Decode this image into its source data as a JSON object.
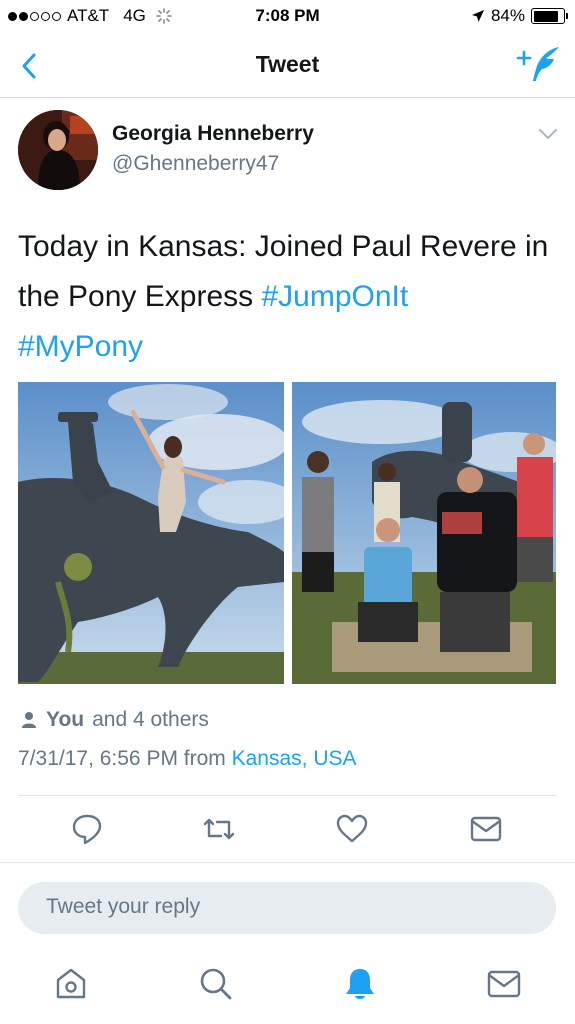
{
  "status_bar": {
    "carrier": "AT&T",
    "network": "4G",
    "time": "7:08 PM",
    "battery": "84%",
    "battery_level": 0.84
  },
  "nav": {
    "title": "Tweet",
    "back_icon": "chevron-left-icon",
    "compose_icon": "compose-tweet-icon"
  },
  "tweet": {
    "author_name": "Georgia Henneberry",
    "author_handle": "@Ghenneberry47",
    "text_plain": "Today in Kansas: Joined Paul Revere in the Pony Express ",
    "hashtag_1": "#JumpOnIt",
    "hashtag_2": "#MyPony",
    "likes_you": "You",
    "likes_rest": "and 4 others",
    "timestamp": "7/31/17, 6:56 PM from ",
    "location": "Kansas, USA"
  },
  "actions": [
    "reply-icon",
    "retweet-icon",
    "like-icon",
    "direct-message-icon"
  ],
  "reply": {
    "placeholder": "Tweet your reply"
  },
  "tab_bar": [
    "home-icon",
    "search-icon",
    "notifications-icon",
    "messages-icon"
  ],
  "colors": {
    "accent": "#1da1f2",
    "secondary_text": "#657786",
    "primary_text": "#14171a",
    "reply_bg": "#e6ecf0"
  }
}
